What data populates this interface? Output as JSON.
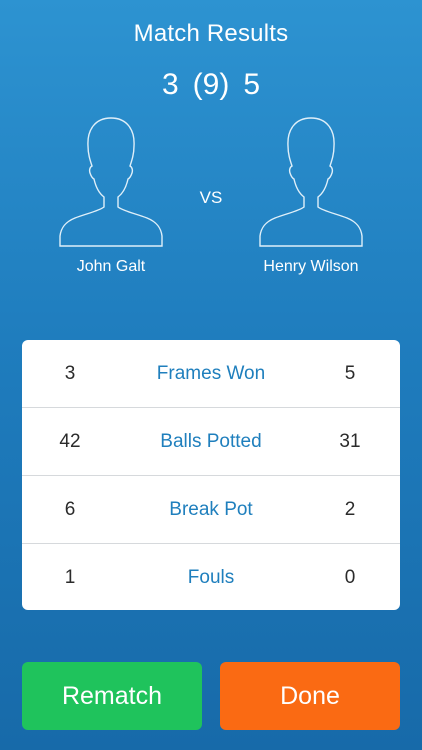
{
  "header": {
    "title": "Match Results"
  },
  "score": {
    "left": "3",
    "middle": "(9)",
    "right": "5"
  },
  "players": {
    "left": {
      "name": "John Galt",
      "avatar_icon": "person-silhouette-icon"
    },
    "right": {
      "name": "Henry Wilson",
      "avatar_icon": "person-silhouette-icon"
    },
    "vs_label": "VS"
  },
  "stats": [
    {
      "label": "Frames Won",
      "left": "3",
      "right": "5"
    },
    {
      "label": "Balls Potted",
      "left": "42",
      "right": "31"
    },
    {
      "label": "Break Pot",
      "left": "6",
      "right": "2"
    },
    {
      "label": "Fouls",
      "left": "1",
      "right": "0"
    }
  ],
  "buttons": {
    "rematch": "Rematch",
    "done": "Done"
  },
  "colors": {
    "background_top": "#2d93d1",
    "background_bottom": "#176aa9",
    "stat_label": "#1f7fbd",
    "rematch": "#1fc35c",
    "done": "#fa6a13"
  }
}
